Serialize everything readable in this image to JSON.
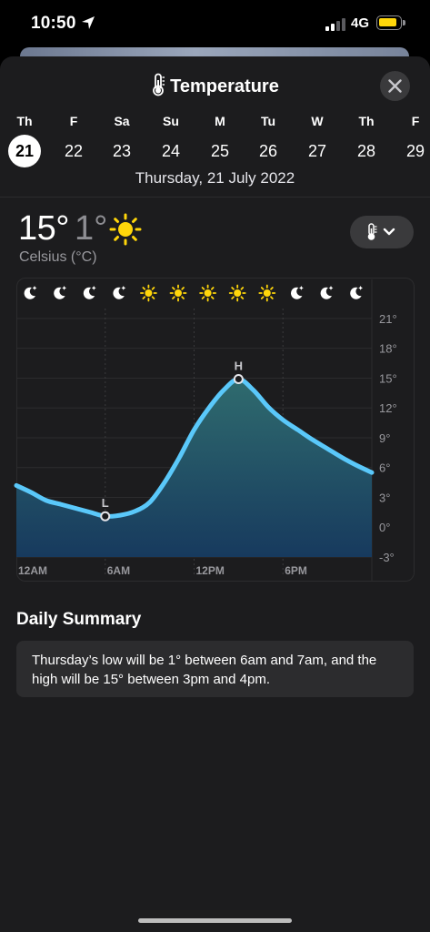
{
  "status": {
    "time": "10:50",
    "network": "4G"
  },
  "sheet": {
    "title": "Temperature"
  },
  "days": [
    {
      "dow": "Th",
      "num": "21",
      "selected": true
    },
    {
      "dow": "F",
      "num": "22"
    },
    {
      "dow": "Sa",
      "num": "23"
    },
    {
      "dow": "Su",
      "num": "24"
    },
    {
      "dow": "M",
      "num": "25"
    },
    {
      "dow": "Tu",
      "num": "26"
    },
    {
      "dow": "W",
      "num": "27"
    },
    {
      "dow": "Th",
      "num": "28"
    },
    {
      "dow": "F",
      "num": "29"
    }
  ],
  "full_date": "Thursday, 21 July 2022",
  "current": {
    "high": "15°",
    "low": "1°",
    "unit": "Celsius (°C)",
    "condition_icon": "sun-icon"
  },
  "chart_data": {
    "type": "area",
    "x": [
      0,
      1,
      2,
      3,
      4,
      5,
      6,
      7,
      8,
      9,
      10,
      11,
      12,
      13,
      14,
      15,
      16,
      17,
      18,
      19,
      20,
      21,
      22,
      23,
      24
    ],
    "values": [
      4.2,
      3.5,
      2.7,
      2.3,
      1.9,
      1.5,
      1.1,
      1.2,
      1.6,
      2.5,
      4.5,
      7.0,
      9.8,
      12.0,
      13.8,
      14.9,
      13.8,
      12.1,
      10.8,
      9.8,
      8.8,
      7.9,
      7.0,
      6.2,
      5.5
    ],
    "ylim": [
      -3,
      22
    ],
    "y_ticks": [
      "21°",
      "18°",
      "15°",
      "12°",
      "9°",
      "6°",
      "3°",
      "0°",
      "-3°"
    ],
    "x_ticks": [
      "12AM",
      "6AM",
      "12PM",
      "6PM"
    ],
    "markers": [
      {
        "label": "L",
        "x": 6,
        "y": 1.1
      },
      {
        "label": "H",
        "x": 15,
        "y": 14.9
      }
    ],
    "conditions": [
      "moon",
      "moon",
      "moon",
      "moon",
      "sun",
      "sun",
      "sun",
      "sun",
      "sun",
      "moon",
      "moon",
      "moon"
    ],
    "colors": {
      "line": "#5ac8fa",
      "fill_top": "#2f6b6e",
      "fill_bottom": "#173a5e"
    }
  },
  "summary": {
    "title": "Daily Summary",
    "text": "Thursday’s low will be 1° between 6am and 7am, and the high will be 15° between 3pm and 4pm."
  }
}
